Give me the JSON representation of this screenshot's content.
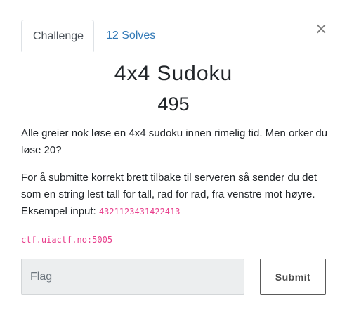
{
  "modal": {
    "close_glyph": "×",
    "tabs": [
      {
        "label": "Challenge",
        "active": true
      },
      {
        "label": "12 Solves",
        "active": false
      }
    ],
    "title": "4x4 Sudoku",
    "points": "495",
    "description_1": "Alle greier nok løse en 4x4 sudoku innen rimelig tid. Men orker du løse 20?",
    "description_2": "For å submitte korrekt brett tilbake til serveren så sender du det som en string lest tall for tall, rad for rad, fra venstre mot høyre. Eksempel input: ",
    "example_input": "4321123431422413",
    "host": "ctf.uiactf.no:5005",
    "flag_placeholder": "Flag",
    "flag_value": "",
    "submit_label": "Submit",
    "colors": {
      "link": "#337ab7",
      "code": "#e83e8c",
      "input_bg": "#eceeef"
    }
  }
}
